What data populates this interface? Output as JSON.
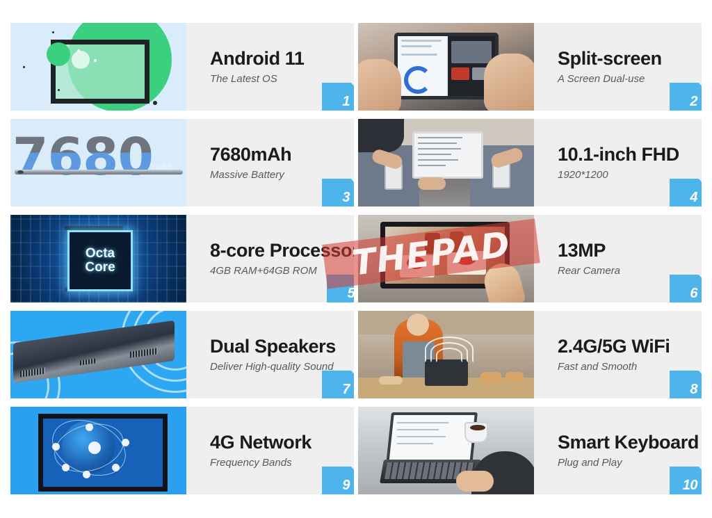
{
  "page": {
    "background_color": "#ffffff",
    "panel_background": "#efefef",
    "badge_color": "#4db4ec",
    "title_color": "#1b1b1b",
    "subtitle_color": "#59595b"
  },
  "watermark": {
    "text": "THEPAD",
    "color": "#d63a32"
  },
  "features": [
    {
      "number": "1",
      "title": "Android 11",
      "subtitle": "The Latest OS",
      "media": "android-logo-illustration",
      "media_background": "#d9ecfb"
    },
    {
      "number": "2",
      "title": "Split-screen",
      "subtitle": "A Screen Dual-use",
      "media": "hands-holding-tablet-split-screen-photo",
      "media_background": "#b09a8a"
    },
    {
      "number": "3",
      "title": "7680mAh",
      "subtitle": "Massive Battery",
      "media": "battery-capacity-graphic",
      "media_background": "#daecfa",
      "media_text": {
        "big_number": "7680",
        "unit": "mAh"
      }
    },
    {
      "number": "4",
      "title": "10.1-inch FHD",
      "subtitle": "1920*1200",
      "media": "people-at-table-with-tablet-photo",
      "media_background": "#b5ada4"
    },
    {
      "number": "5",
      "title": "8-core Processor",
      "subtitle": "4GB RAM+64GB ROM",
      "media": "octa-core-chip-graphic",
      "media_background": "#0d3f7e",
      "media_text": {
        "line1": "Octa",
        "line2": "Core"
      }
    },
    {
      "number": "6",
      "title": "13MP",
      "subtitle": "Rear Camera",
      "media": "tablet-photographing-food-photo",
      "media_background": "#ada69d"
    },
    {
      "number": "7",
      "title": "Dual Speakers",
      "subtitle": "Deliver High-quality Sound",
      "media": "tablet-side-profile-soundwaves-graphic",
      "media_background": "#2ea7f2"
    },
    {
      "number": "8",
      "title": "2.4G/5G WiFi",
      "subtitle": "Fast and Smooth",
      "media": "woman-in-kitchen-with-tablet-photo",
      "media_background": "#b8a895"
    },
    {
      "number": "9",
      "title": "4G Network",
      "subtitle": "Frequency Bands",
      "media": "global-network-globe-graphic",
      "media_background": "#2b9ff0"
    },
    {
      "number": "10",
      "title": "Smart Keyboard",
      "subtitle": "Plug and Play",
      "media": "tablet-with-keyboard-typing-photo",
      "media_background": "#c3c7cb"
    }
  ]
}
